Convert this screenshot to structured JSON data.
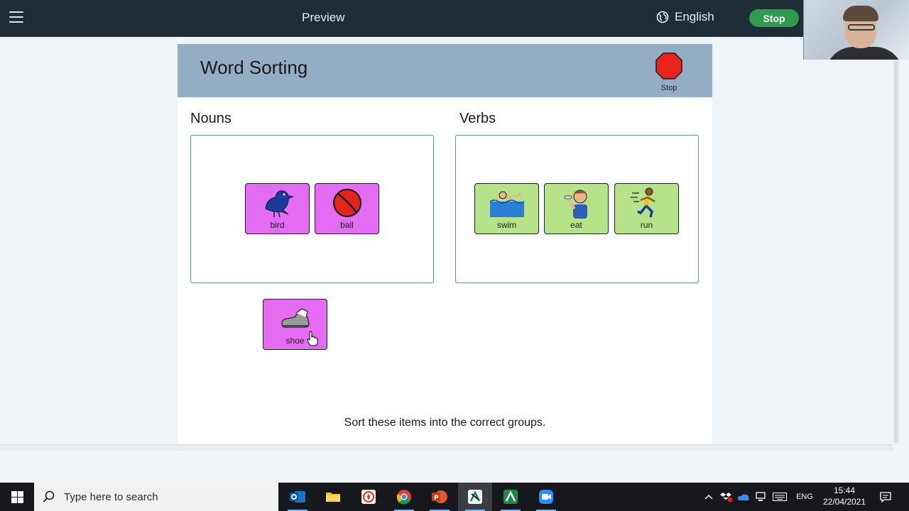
{
  "topbar": {
    "title": "Preview",
    "language": "English",
    "stop_label": "Stop"
  },
  "activity": {
    "title": "Word Sorting",
    "stop_icon_label": "Stop",
    "groups": [
      {
        "label": "Nouns"
      },
      {
        "label": "Verbs"
      }
    ],
    "cards": {
      "bird": "bird",
      "ball": "ball",
      "swim": "swim",
      "eat": "eat",
      "run": "run",
      "shoe": "shoe"
    },
    "instructions": "Sort these items into the correct groups."
  },
  "taskbar": {
    "search_placeholder": "Type here to search",
    "language": "ENG",
    "time": "15:44",
    "date": "22/04/2021"
  },
  "colors": {
    "topbar": "#1f2d37",
    "stop_green": "#2e9b4f",
    "header_blue": "#93aec4",
    "noun_card": "#e36cf2",
    "verb_card": "#b6e28a",
    "group_border": "#5f9b97"
  }
}
